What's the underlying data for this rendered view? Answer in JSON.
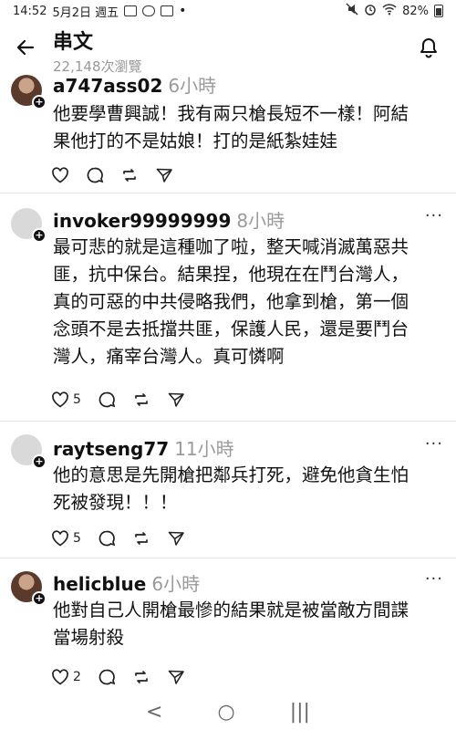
{
  "status": {
    "time": "14:52",
    "date": "5月2日 週五",
    "dot": "•",
    "battery": "82%"
  },
  "header": {
    "title": "串文",
    "views": "22,148次瀏覽"
  },
  "comments": [
    {
      "user": "a747ass02",
      "time": "6小時",
      "body_lines": [
        "他要學曹興誠！我有兩只槍長短不一樣！阿結",
        "果他打的不是姑娘！打的是紙紮娃娃"
      ],
      "likes": ""
    },
    {
      "user": "invoker99999999",
      "time": "8小時",
      "body_lines": [
        "最可悲的就是這種咖了啦，整天喊消滅萬惡共",
        "匪，抗中保台。結果捏，他現在在鬥台灣人，",
        "真的可惡的中共侵略我們，他拿到槍，第一個",
        "念頭不是去抵擋共匪，保護人民，還是要鬥台",
        "灣人，痛宰台灣人。真可憐啊"
      ],
      "likes": "5"
    },
    {
      "user": "raytseng77",
      "time": "11小時",
      "body_lines": [
        "他的意思是先開槍把鄰兵打死，避免他貪生怕",
        "死被發現！！！"
      ],
      "likes": "5"
    },
    {
      "user": "helicblue",
      "time": "6小時",
      "body_lines": [
        "他對自己人開槍最慘的結果就是被當敵方間諜",
        "當場射殺"
      ],
      "likes": "2"
    }
  ],
  "more_label": "···",
  "nav": {
    "back": "<",
    "home": "○",
    "recents": "|||"
  }
}
